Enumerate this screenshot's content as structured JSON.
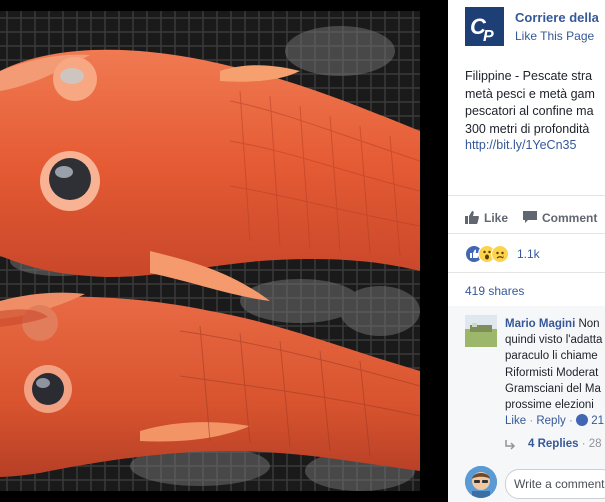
{
  "page": {
    "name": "Corriere della",
    "like_page_label": "Like This Page",
    "separator": "·"
  },
  "post": {
    "text": "Filippine - Pescate stra\nmetà pesci e metà gam\npescatori al confine ma\n300 metri di profondità",
    "link": "http://bit.ly/1YeCn35"
  },
  "actions": {
    "like_label": "Like",
    "comment_label": "Comment"
  },
  "reactions": {
    "count": "1.1k",
    "icons": [
      "like-icon",
      "wow-icon",
      "sad-icon"
    ],
    "colors": {
      "like": "#4267b2",
      "emoji": "#fcd34d"
    }
  },
  "shares": {
    "label": "419 shares"
  },
  "comment": {
    "author": "Mario Magini",
    "text_first": " Non",
    "text_rest": "quindi visto l'adatta\nparaculo li chiame\nRiformisti Moderat\nGramsciani del Ma\nprossime elezioni",
    "like_label": "Like",
    "reply_label": "Reply",
    "like_count": "21",
    "separator": "·"
  },
  "replies": {
    "label": "4 Replies",
    "time": "28"
  },
  "composer": {
    "placeholder": "Write a comment..."
  },
  "colors": {
    "brand": "#365899",
    "logo_bg": "#1e3f75",
    "fish": "#e8603c"
  }
}
